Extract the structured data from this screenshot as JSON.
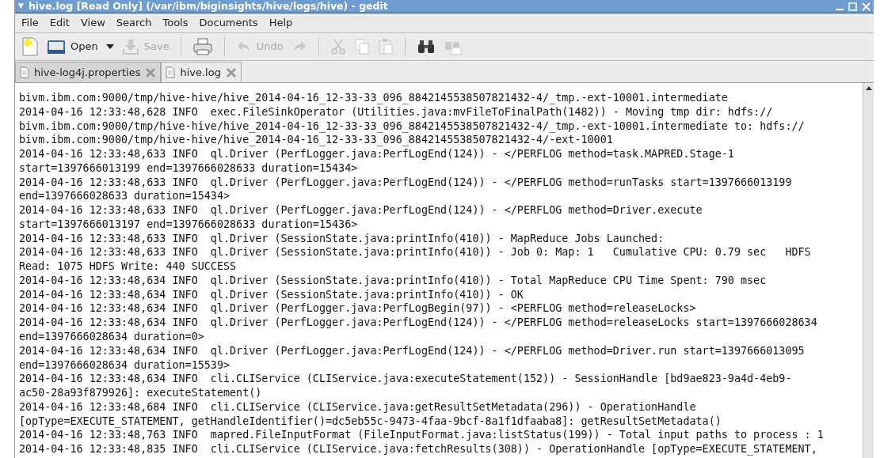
{
  "window": {
    "menu_glyph": "▼",
    "title": "hive.log [Read Only] (/var/ibm/biginsights/hive/logs/hive) - gedit"
  },
  "menu": [
    "File",
    "Edit",
    "View",
    "Search",
    "Tools",
    "Documents",
    "Help"
  ],
  "toolbar": [
    {
      "kind": "new",
      "disabled": false
    },
    {
      "kind": "open",
      "label": "Open",
      "disabled": false
    },
    {
      "kind": "dropdown",
      "disabled": false
    },
    {
      "kind": "save",
      "label": "Save",
      "disabled": true
    },
    {
      "kind": "sep"
    },
    {
      "kind": "print",
      "disabled": false
    },
    {
      "kind": "sep"
    },
    {
      "kind": "undo",
      "label": "Undo",
      "disabled": true
    },
    {
      "kind": "redo",
      "disabled": true
    },
    {
      "kind": "sep"
    },
    {
      "kind": "cut",
      "disabled": true
    },
    {
      "kind": "copy",
      "disabled": true
    },
    {
      "kind": "paste",
      "disabled": true
    },
    {
      "kind": "sep"
    },
    {
      "kind": "find",
      "disabled": false
    },
    {
      "kind": "replace",
      "disabled": true
    }
  ],
  "tabs": [
    {
      "label": "hive-log4j.properties",
      "selected": false
    },
    {
      "label": "hive.log",
      "selected": true
    }
  ],
  "lines": [
    "bivm.ibm.com:9000/tmp/hive-hive/hive_2014-04-16_12-33-33_096_8842145538507821432-4/_tmp.-ext-10001.intermediate",
    "2014-04-16 12:33:48,628 INFO  exec.FileSinkOperator (Utilities.java:mvFileToFinalPath(1482)) - Moving tmp dir: hdfs://",
    "bivm.ibm.com:9000/tmp/hive-hive/hive_2014-04-16_12-33-33_096_8842145538507821432-4/_tmp.-ext-10001.intermediate to: hdfs://",
    "bivm.ibm.com:9000/tmp/hive-hive/hive_2014-04-16_12-33-33_096_8842145538507821432-4/-ext-10001",
    "2014-04-16 12:33:48,633 INFO  ql.Driver (PerfLogger.java:PerfLogEnd(124)) - </PERFLOG method=task.MAPRED.Stage-1",
    "start=1397666013199 end=1397666028633 duration=15434>",
    "2014-04-16 12:33:48,633 INFO  ql.Driver (PerfLogger.java:PerfLogEnd(124)) - </PERFLOG method=runTasks start=1397666013199",
    "end=1397666028633 duration=15434>",
    "2014-04-16 12:33:48,633 INFO  ql.Driver (PerfLogger.java:PerfLogEnd(124)) - </PERFLOG method=Driver.execute",
    "start=1397666013197 end=1397666028633 duration=15436>",
    "2014-04-16 12:33:48,633 INFO  ql.Driver (SessionState.java:printInfo(410)) - MapReduce Jobs Launched:",
    "2014-04-16 12:33:48,633 INFO  ql.Driver (SessionState.java:printInfo(410)) - Job 0: Map: 1   Cumulative CPU: 0.79 sec   HDFS",
    "Read: 1075 HDFS Write: 440 SUCCESS",
    "2014-04-16 12:33:48,634 INFO  ql.Driver (SessionState.java:printInfo(410)) - Total MapReduce CPU Time Spent: 790 msec",
    "2014-04-16 12:33:48,634 INFO  ql.Driver (SessionState.java:printInfo(410)) - OK",
    "2014-04-16 12:33:48,634 INFO  ql.Driver (PerfLogger.java:PerfLogBegin(97)) - <PERFLOG method=releaseLocks>",
    "2014-04-16 12:33:48,634 INFO  ql.Driver (PerfLogger.java:PerfLogEnd(124)) - </PERFLOG method=releaseLocks start=1397666028634",
    "end=1397666028634 duration=0>",
    "2014-04-16 12:33:48,634 INFO  ql.Driver (PerfLogger.java:PerfLogEnd(124)) - </PERFLOG method=Driver.run start=1397666013095",
    "end=1397666028634 duration=15539>",
    "2014-04-16 12:33:48,634 INFO  cli.CLIService (CLIService.java:executeStatement(152)) - SessionHandle [bd9ae823-9a4d-4eb9-",
    "ac50-28a93f879926]: executeStatement()",
    "2014-04-16 12:33:48,684 INFO  cli.CLIService (CLIService.java:getResultSetMetadata(296)) - OperationHandle",
    "[opType=EXECUTE_STATEMENT, getHandleIdentifier()=dc5eb55c-9473-4faa-9bcf-8a1f1dfaaba8]: getResultSetMetadata()",
    "2014-04-16 12:33:48,763 INFO  mapred.FileInputFormat (FileInputFormat.java:listStatus(199)) - Total input paths to process : 1",
    "2014-04-16 12:33:48,835 INFO  cli.CLIService (CLIService.java:fetchResults(308)) - OperationHandle [opType=EXECUTE_STATEMENT,"
  ]
}
